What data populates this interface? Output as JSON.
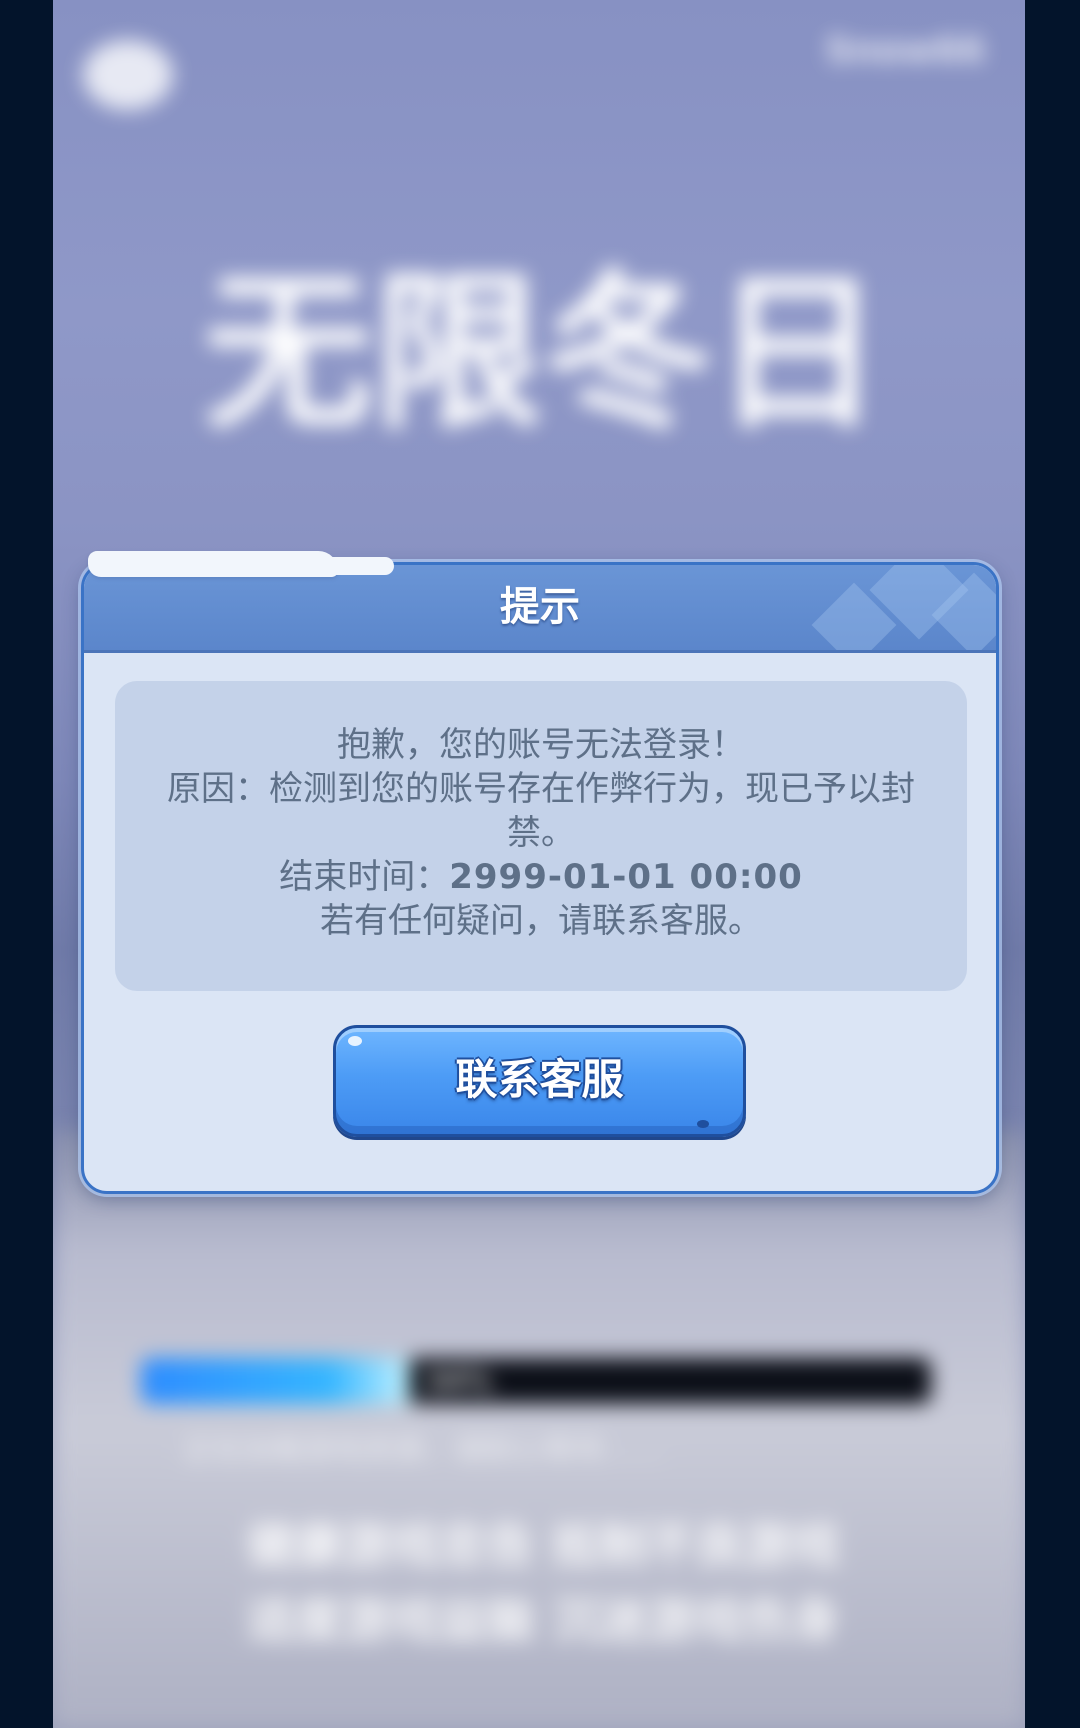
{
  "background": {
    "game_logo": "无限冬日",
    "top_right_text": "Snow66",
    "loading_percent_text": "34%",
    "loading_progress": 0.34,
    "tip_text": "正在加载游戏资源，请耐心等待……",
    "notice_lines": [
      "健康游戏忠告 抵制不良游戏",
      "适度游戏益脑 沉迷游戏伤身"
    ]
  },
  "dialog": {
    "title": "提示",
    "message": {
      "line1": "抱歉，您的账号无法登录！",
      "line2": "原因：检测到您的账号存在作弊行为，现已予以封",
      "line3": "禁。",
      "end_time_label": "结束时间：",
      "end_time_value": "2999-01-01 00:00",
      "line5": "若有任何疑问，请联系客服。"
    },
    "contact_button_label": "联系客服"
  },
  "colors": {
    "dialog_bg": "#dbe5f5",
    "header_bg": "#5b86cb",
    "message_bg": "#c4d2e9",
    "message_text": "#5e7088",
    "button_blue": "#4d9cf6",
    "side_bars": "#03142b"
  }
}
